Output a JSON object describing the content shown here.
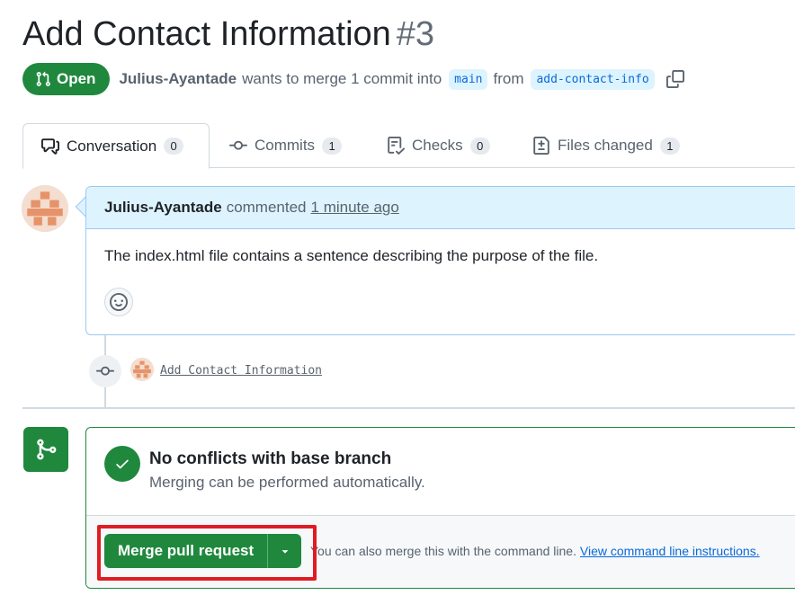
{
  "pr": {
    "title": "Add Contact Information",
    "number": "#3",
    "state": "Open",
    "author": "Julius-Ayantade",
    "merge_text": "wants to merge 1 commit into",
    "base_branch": "main",
    "from_text": "from",
    "head_branch": "add-contact-info"
  },
  "tabs": [
    {
      "label": "Conversation",
      "count": "0",
      "icon": "comment-discussion-icon"
    },
    {
      "label": "Commits",
      "count": "1",
      "icon": "git-commit-icon"
    },
    {
      "label": "Checks",
      "count": "0",
      "icon": "checklist-icon"
    },
    {
      "label": "Files changed",
      "count": "1",
      "icon": "file-diff-icon"
    }
  ],
  "comment": {
    "author": "Julius-Ayantade",
    "action": "commented",
    "time": "1 minute ago",
    "body": "The index.html file contains a sentence describing the purpose of the file."
  },
  "commit": {
    "message": "Add Contact Information"
  },
  "merge": {
    "status_title": "No conflicts with base branch",
    "status_sub": "Merging can be performed automatically.",
    "button_label": "Merge pull request",
    "hint_text": "You can also merge this with the command line.",
    "hint_link": "View command line instructions."
  },
  "colors": {
    "success": "#1f883d",
    "accent": "#0969da",
    "highlight": "#e01b24"
  }
}
